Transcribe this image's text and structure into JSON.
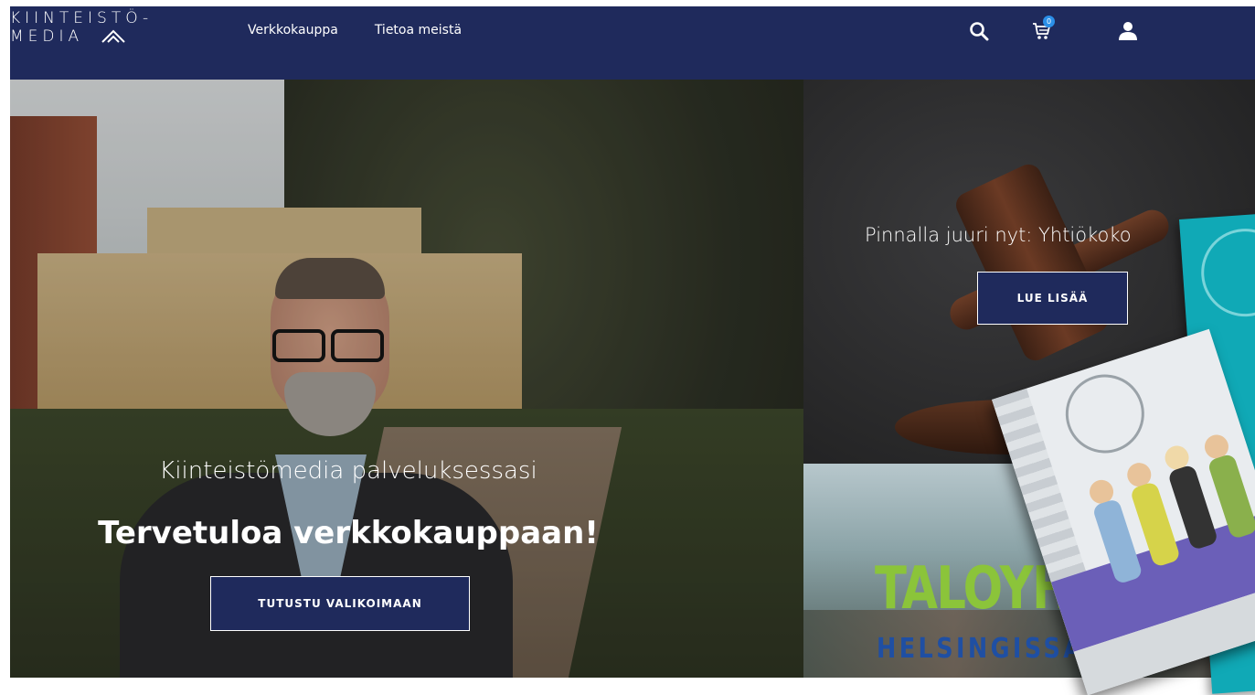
{
  "header": {
    "logo_line1": "KIINTEISTÖ-",
    "logo_line2": "MEDIA",
    "nav": [
      {
        "label": "Verkkokauppa"
      },
      {
        "label": "Tietoa meistä"
      }
    ],
    "cart_count": "0",
    "colors": {
      "background": "#1f2a5c"
    },
    "icons": [
      "search-icon",
      "cart-icon",
      "user-icon"
    ]
  },
  "hero": {
    "subtitle": "Kiinteistömedia palveluksessasi",
    "title": "Tervetuloa verkkokauppaan!",
    "button_label": "TUTUSTU VALIKOIMAAN"
  },
  "promo": {
    "text": "Pinnalla juuri nyt: Yhtiökoko",
    "button_label": "LUE LISÄÄ"
  },
  "event": {
    "title": "TALOYH",
    "subtitle": "HELSINGISSÄ"
  },
  "colors": {
    "primary": "#1f2a5c",
    "button_border": "#ffffff",
    "event_green": "#8bc43a",
    "event_blue": "#1f4fa3",
    "book_teal": "#10a9b6"
  }
}
